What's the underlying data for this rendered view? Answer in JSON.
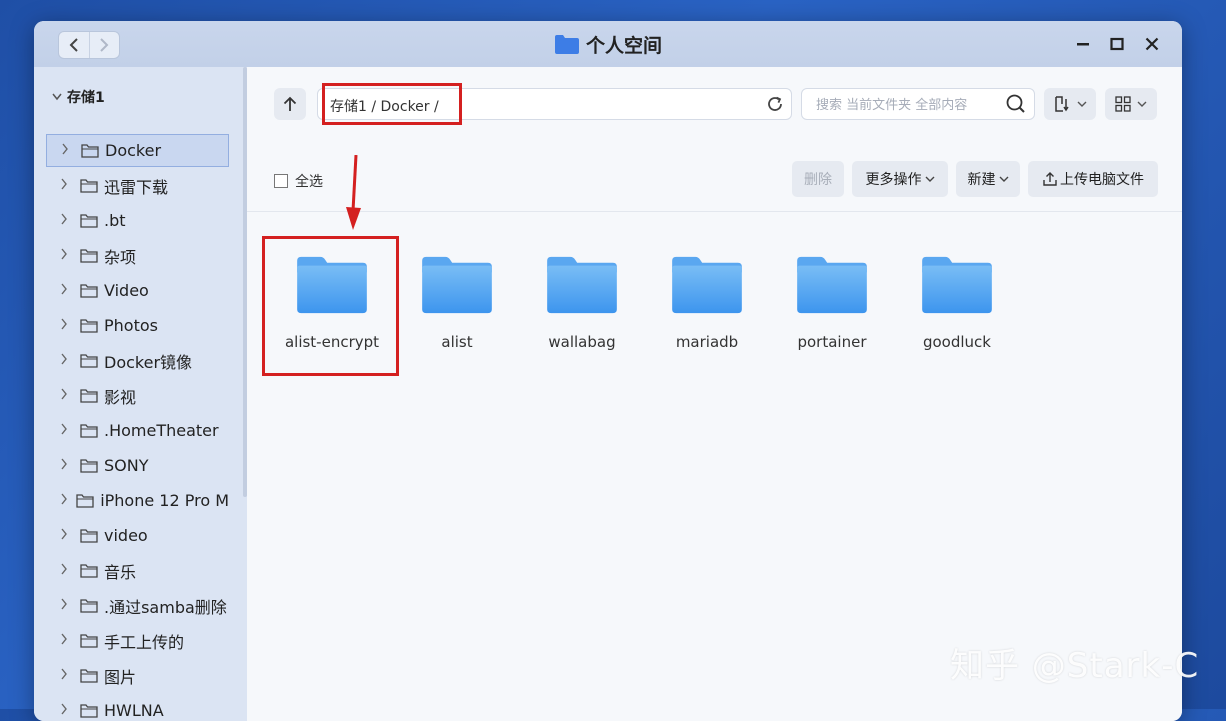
{
  "window": {
    "title": "个人空间"
  },
  "sidebar": {
    "root_label": "存储1",
    "items": [
      {
        "label": "Docker",
        "selected": true
      },
      {
        "label": "迅雷下载"
      },
      {
        "label": ".bt"
      },
      {
        "label": "杂项"
      },
      {
        "label": "Video"
      },
      {
        "label": "Photos"
      },
      {
        "label": "Docker镜像"
      },
      {
        "label": "影视"
      },
      {
        "label": ".HomeTheater"
      },
      {
        "label": "SONY"
      },
      {
        "label": "iPhone 12 Pro M"
      },
      {
        "label": "video"
      },
      {
        "label": "音乐"
      },
      {
        "label": ".通过samba删除"
      },
      {
        "label": "手工上传的"
      },
      {
        "label": "图片"
      },
      {
        "label": "HWLNA"
      }
    ]
  },
  "toolbar": {
    "path": "存储1 / Docker /",
    "search_placeholder": "搜索 当前文件夹 全部内容",
    "select_all": "全选",
    "delete": "删除",
    "more_actions": "更多操作",
    "new": "新建",
    "upload": "上传电脑文件"
  },
  "files": [
    {
      "name": "alist-encrypt"
    },
    {
      "name": "alist"
    },
    {
      "name": "wallabag"
    },
    {
      "name": "mariadb"
    },
    {
      "name": "portainer"
    },
    {
      "name": "goodluck"
    }
  ],
  "watermark": "知乎 @Stark-C",
  "colors": {
    "accent": "#4a90e8",
    "highlight": "#d42020"
  }
}
